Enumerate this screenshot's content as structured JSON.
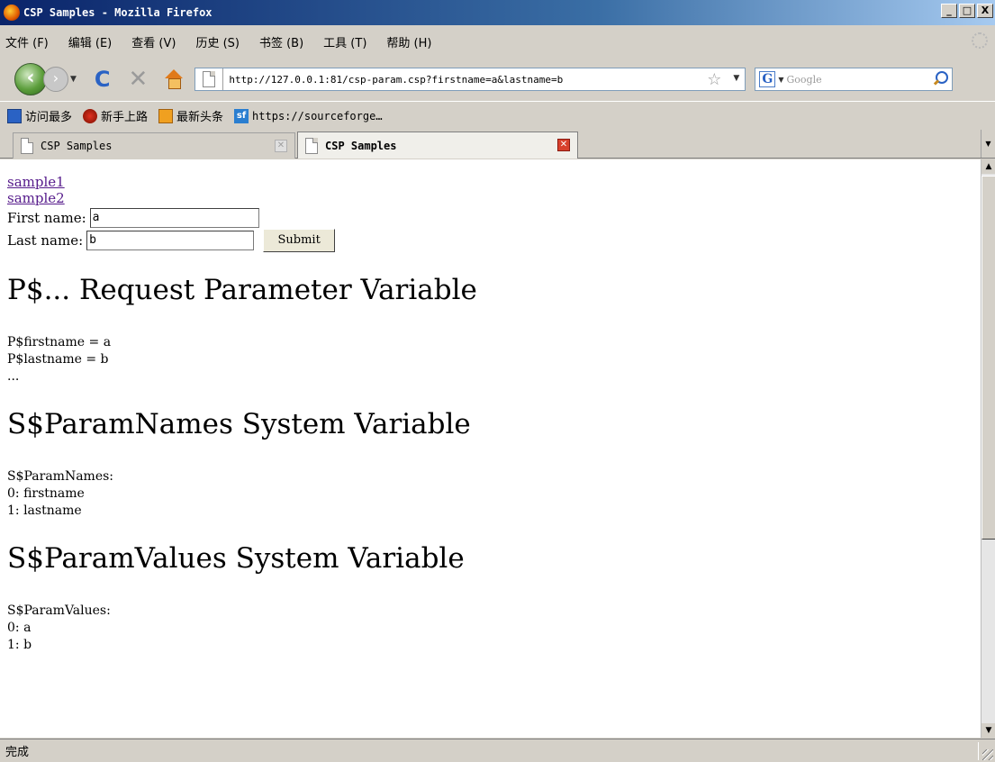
{
  "window": {
    "title": "CSP Samples - Mozilla Firefox",
    "buttons": [
      "_",
      "□",
      "X"
    ]
  },
  "menu": [
    "文件 (F)",
    "编辑 (E)",
    "查看 (V)",
    "历史 (S)",
    "书签 (B)",
    "工具 (T)",
    "帮助 (H)"
  ],
  "nav": {
    "url": "http://127.0.0.1:81/csp-param.csp?firstname=a&lastname=b",
    "search_placeholder": "Google",
    "google_letter": "G"
  },
  "bookmarks": [
    {
      "label": "访问最多",
      "icon": "most-visited-icon"
    },
    {
      "label": "新手上路",
      "icon": "getting-started-icon"
    },
    {
      "label": "最新头条",
      "icon": "rss-feed-icon"
    },
    {
      "label": "https://sourceforge…",
      "icon": "sourceforge-icon",
      "icon_text": "sf"
    }
  ],
  "tabs": [
    {
      "label": "CSP Samples",
      "active": false
    },
    {
      "label": "CSP Samples",
      "active": true
    }
  ],
  "page": {
    "links": [
      "sample1",
      "sample2"
    ],
    "form": {
      "first_label": "First name:",
      "first_value": "a",
      "last_label": "Last name:",
      "last_value": "b",
      "submit_label": "Submit"
    },
    "sections": [
      {
        "heading": "P$... Request Parameter Variable",
        "lines": [
          "P$firstname = a",
          "P$lastname = b",
          "..."
        ]
      },
      {
        "heading": "S$ParamNames System Variable",
        "lines": [
          "S$ParamNames:",
          "0: firstname",
          "1: lastname"
        ]
      },
      {
        "heading": "S$ParamValues System Variable",
        "lines": [
          "S$ParamValues:",
          "0: a",
          "1: b"
        ]
      }
    ]
  },
  "status": {
    "text": "完成"
  }
}
